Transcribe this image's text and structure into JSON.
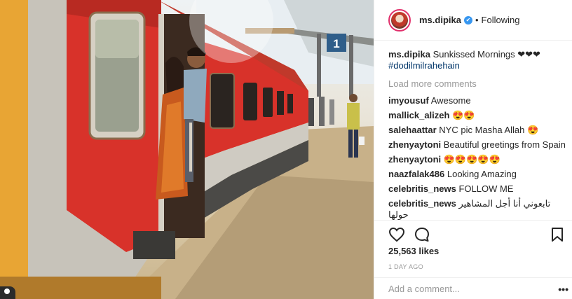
{
  "post": {
    "username": "ms.dipika",
    "follow_status": "Following",
    "separator": "•",
    "caption_user": "ms.dipika",
    "caption_text": "Sunkissed Mornings ❤❤❤",
    "hashtag": "#dodilmilrahehain",
    "load_more": "Load more comments",
    "comments": [
      {
        "user": "imyousuf",
        "text": "Awesome"
      },
      {
        "user": "mallick_alizeh",
        "text": "😍😍"
      },
      {
        "user": "salehaattar",
        "text": "NYC pic Masha Allah 😍"
      },
      {
        "user": "zhenyaytoni",
        "text": "Beautiful greetings from Spain"
      },
      {
        "user": "zhenyaytoni",
        "text": "😍😍😍😍😍"
      },
      {
        "user": "naazfalak486",
        "text": "Looking Amazing"
      },
      {
        "user": "celebritis_news",
        "text": "FOLLOW ME"
      },
      {
        "user": "celebritis_news",
        "text": "تابعوني أنا أجل المشاهير حولها"
      }
    ],
    "likes": "25,563 likes",
    "time": "1 DAY AGO",
    "add_comment_placeholder": "Add a comment...",
    "more_options": "•••"
  },
  "photo": {
    "platform_number": "1",
    "colors": {
      "train_red": "#d8322a",
      "train_grey": "#c9c6bd",
      "sky": "#eef2f4",
      "platform": "#c9b48d",
      "accent_blue": "#3897f0"
    }
  },
  "icons": [
    "heart-icon",
    "comment-icon",
    "bookmark-icon",
    "verified-icon",
    "more-options-icon"
  ]
}
